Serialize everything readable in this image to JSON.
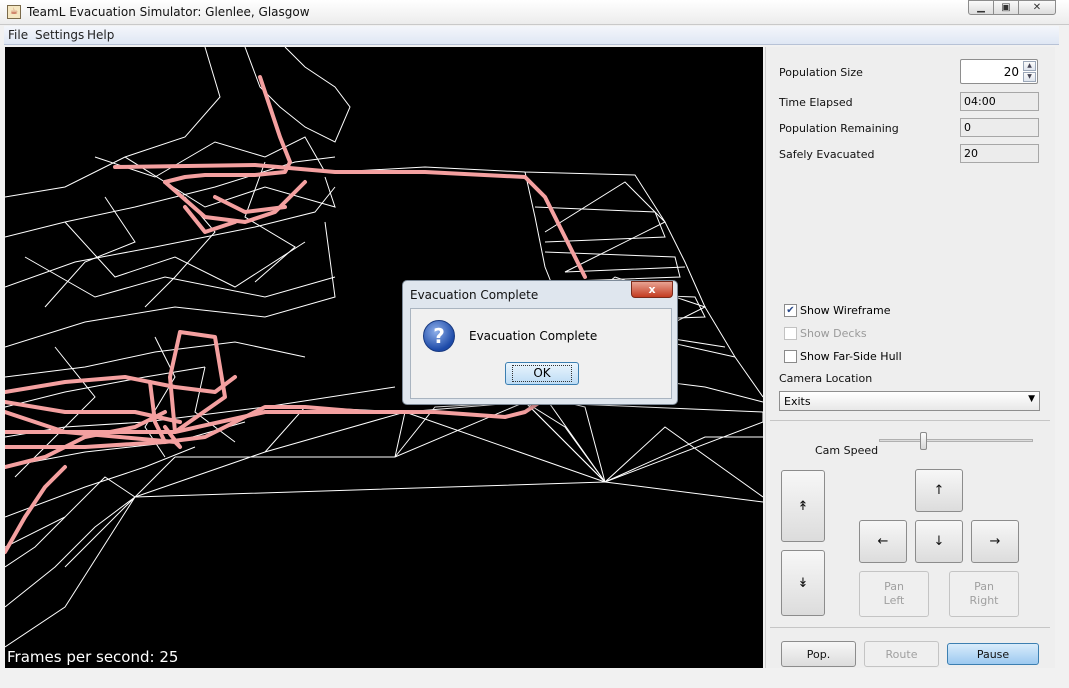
{
  "window": {
    "title": "TeamL Evacuation Simulator: Glenlee, Glasgow",
    "app_icon": "java-icon",
    "controls": [
      "minimize-icon",
      "maximize-icon",
      "close-icon"
    ]
  },
  "menu": [
    "File",
    "Settings",
    "Help"
  ],
  "viewport": {
    "fps_text": "Frames per second: 25",
    "wire_color": "#ffffff",
    "route_color": "#f4a0a0"
  },
  "stats": {
    "population_size_label": "Population Size",
    "population_size_value": "20",
    "time_elapsed_label": "Time Elapsed",
    "time_elapsed_value": "04:00",
    "population_remaining_label": "Population Remaining",
    "population_remaining_value": "0",
    "safely_evacuated_label": "Safely Evacuated",
    "safely_evacuated_value": "20"
  },
  "options": {
    "show_wireframe": {
      "label": "Show Wireframe",
      "checked": true,
      "enabled": true
    },
    "show_decks": {
      "label": "Show Decks",
      "checked": false,
      "enabled": false
    },
    "show_far_side_hull": {
      "label": "Show Far-Side Hull",
      "checked": false,
      "enabled": true
    }
  },
  "camera": {
    "location_label": "Camera Location",
    "location_value": "Exits",
    "speed_label": "Cam Speed",
    "speed_level": 0.3
  },
  "nav_buttons": {
    "up_glyph": "↑",
    "down_glyph": "↓",
    "left_glyph": "←",
    "right_glyph": "→",
    "raise_glyph": "↟",
    "lower_glyph": "↡",
    "pan_left": "Pan\nLeft",
    "pan_right": "Pan\nRight"
  },
  "bottom_buttons": {
    "pop": "Pop.",
    "route": "Route",
    "pause": "Pause"
  },
  "dialog": {
    "title": "Evacuation Complete",
    "close_glyph": "x",
    "icon": "question-icon",
    "message": "Evacuation Complete",
    "ok": "OK"
  },
  "colors": {
    "accent": "#3c7fb1",
    "close_red": "#c33b20"
  }
}
